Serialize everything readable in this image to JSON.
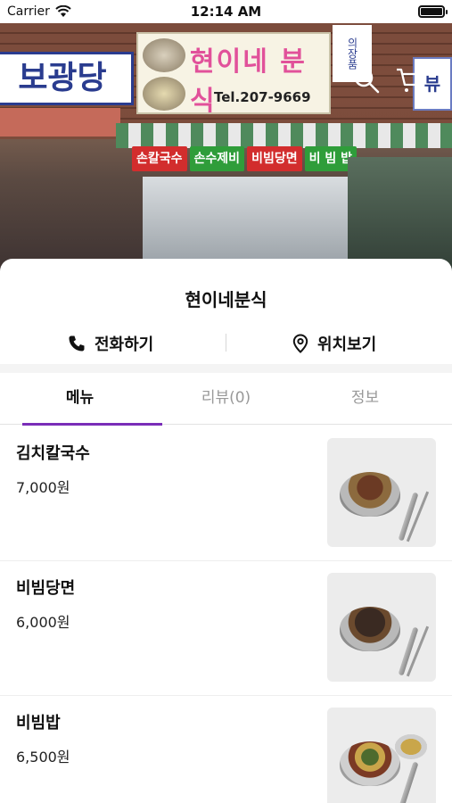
{
  "status_bar": {
    "carrier": "Carrier",
    "time": "12:14 AM"
  },
  "hero": {
    "sign_left_text": "보광당",
    "sign_main_title": "현이네 분식",
    "sign_main_tel": "Tel.207-9669",
    "sign_right_text": "의장품",
    "view_tag": "뷰",
    "menu_boards": [
      "손칼국수",
      "손수제비",
      "비빔당면",
      "비 빔 밥"
    ]
  },
  "store": {
    "name": "현이네분식"
  },
  "actions": {
    "call_label": "전화하기",
    "map_label": "위치보기"
  },
  "tabs": [
    {
      "label": "메뉴"
    },
    {
      "label": "리뷰(0)"
    },
    {
      "label": "정보"
    }
  ],
  "menu_items": [
    {
      "name": "김치칼국수",
      "price": "7,000원"
    },
    {
      "name": "비빔당면",
      "price": "6,000원"
    },
    {
      "name": "비빔밥",
      "price": "6,500원"
    }
  ],
  "colors": {
    "accent": "#7a2db8",
    "inactive_tab": "#999999"
  },
  "icons": [
    "wifi-icon",
    "battery-icon",
    "search-icon",
    "cart-icon",
    "phone-icon",
    "location-pin-icon"
  ]
}
